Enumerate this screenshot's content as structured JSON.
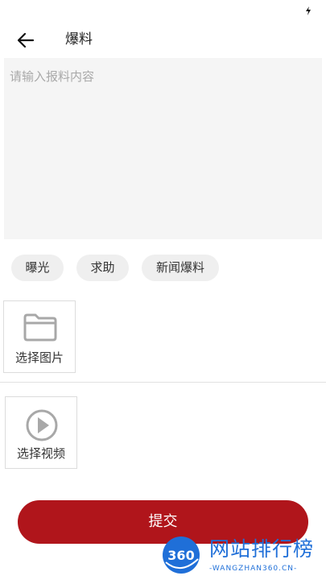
{
  "status_bar": {
    "icon": "bolt-icon"
  },
  "header": {
    "back_icon": "arrow-left-icon",
    "title": "爆料"
  },
  "content": {
    "value": "",
    "placeholder": "请输入报料内容"
  },
  "tags": [
    {
      "label": "曝光"
    },
    {
      "label": "求助"
    },
    {
      "label": "新闻爆料"
    }
  ],
  "media": {
    "image_picker": {
      "icon": "folder-icon",
      "label": "选择图片"
    },
    "video_picker": {
      "icon": "play-circle-icon",
      "label": "选择视频"
    }
  },
  "submit": {
    "label": "提交"
  },
  "watermark": {
    "logo_text": "360",
    "title": "网站排行榜",
    "subtitle": "-WANGZHAN360.CN-"
  },
  "colors": {
    "accent": "#b0151b",
    "input_background": "#f5f5f5",
    "tag_background": "#efefef",
    "watermark_blue": "#1f6fd8"
  }
}
